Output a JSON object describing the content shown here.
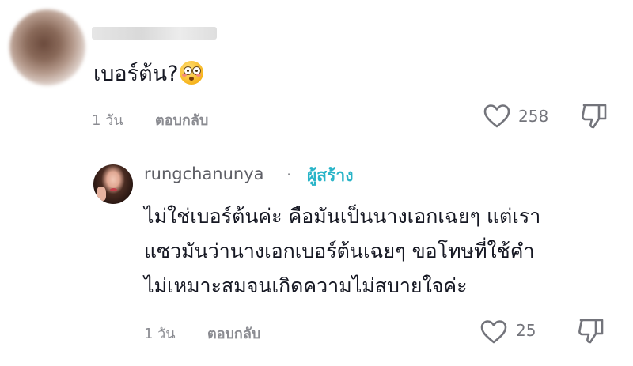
{
  "comment": {
    "text": "เบอร์ต้น?",
    "emoji_icon": "flushed-face-icon",
    "time": "1 วัน",
    "reply_label": "ตอบกลับ",
    "likes": "258"
  },
  "reply": {
    "author": "rungchanunya",
    "separator": "·",
    "creator_badge": "ผู้สร้าง",
    "lines": [
      "ไม่ใช่เบอร์ต้นค่ะ คือมันเป็นนางเอกเฉยๆ แต่เรา",
      "แซวมันว่านางเอกเบอร์ต้นเฉยๆ ขอโทษที่ใช้คำ",
      "ไม่เหมาะสมจนเกิดความไม่สบายใจค่ะ"
    ],
    "time": "1 วัน",
    "reply_label": "ตอบกลับ",
    "likes": "25"
  },
  "colors": {
    "text": "#161823",
    "muted": "#8a8b91",
    "creator": "#28b4c8"
  }
}
